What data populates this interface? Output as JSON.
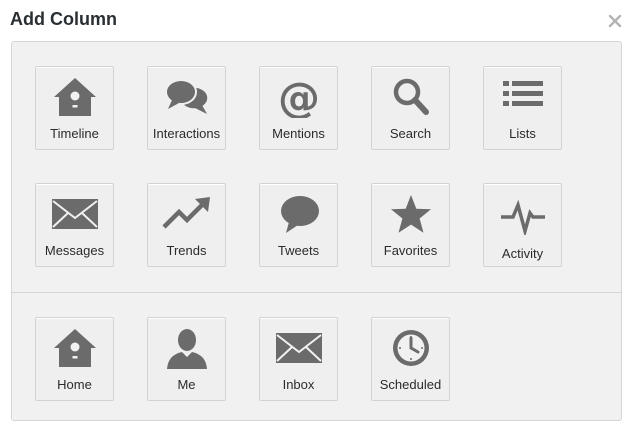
{
  "dialog": {
    "title": "Add Column"
  },
  "columns": [
    {
      "label": "Timeline",
      "icon": "birdhouse-icon"
    },
    {
      "label": "Interactions",
      "icon": "speech-bubbles-icon"
    },
    {
      "label": "Mentions",
      "icon": "at-sign-icon"
    },
    {
      "label": "Search",
      "icon": "magnifier-icon"
    },
    {
      "label": "Lists",
      "icon": "list-icon"
    },
    {
      "label": "Messages",
      "icon": "envelope-icon"
    },
    {
      "label": "Trends",
      "icon": "trend-arrow-icon"
    },
    {
      "label": "Tweets",
      "icon": "speech-bubble-icon"
    },
    {
      "label": "Favorites",
      "icon": "star-icon"
    },
    {
      "label": "Activity",
      "icon": "pulse-icon"
    }
  ],
  "user_columns": [
    {
      "label": "Home",
      "icon": "birdhouse-icon"
    },
    {
      "label": "Me",
      "icon": "person-icon"
    },
    {
      "label": "Inbox",
      "icon": "envelope-icon"
    },
    {
      "label": "Scheduled",
      "icon": "clock-icon"
    }
  ],
  "colors": {
    "icon": "#6b6b6b",
    "panel": "#f1f1f1",
    "border": "#d3d3d3"
  }
}
